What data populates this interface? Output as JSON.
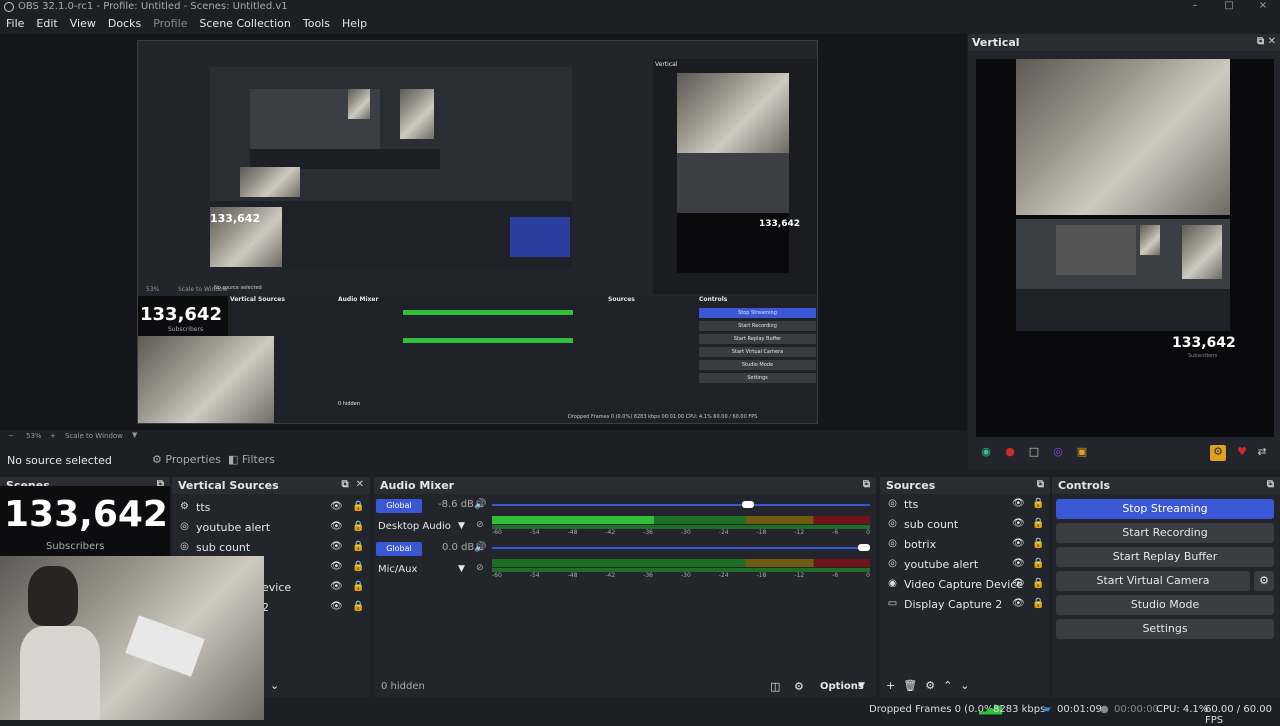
{
  "window": {
    "title": "OBS 32.1.0-rc1 - Profile: Untitled - Scenes: Untitled.v1",
    "min": "–",
    "max": "□",
    "close": "×"
  },
  "menu": [
    "File",
    "Edit",
    "View",
    "Docks",
    "Profile",
    "Scene Collection",
    "Tools",
    "Help"
  ],
  "nested_capture": {
    "counter": "133,642",
    "counter_sub": "Subscribers",
    "no_source": "No source selected",
    "properties": "Properties",
    "filters": "Filters",
    "dock_vertical_sources": "Vertical Sources",
    "dock_audio_mixer": "Audio Mixer",
    "dock_sources": "Sources",
    "dock_controls": "Controls",
    "stop_streaming": "Stop Streaming",
    "start_recording": "Start Recording",
    "start_replay": "Start Replay Buffer",
    "start_vcam": "Start Virtual Camera",
    "studio_mode": "Studio Mode",
    "settings": "Settings",
    "hidden": "0 hidden",
    "options": "Options",
    "vertical": "Vertical",
    "zoom": "53%",
    "scale": "Scale to Window",
    "status": "Dropped Frames 0 (0.0%)   8283 kbps   00:01:00   CPU: 4.1%   60.00 / 60.00 FPS"
  },
  "zoom_bar": {
    "zoom": "53%",
    "scale": "Scale to Window"
  },
  "source_bar": {
    "no_source": "No source selected",
    "properties": "Properties",
    "filters": "Filters"
  },
  "vertical_dock": {
    "title": "Vertical",
    "counter": "133,642",
    "counter_sub": "Subscribers"
  },
  "scenes_dock": {
    "title": "Scenes"
  },
  "overlay": {
    "counter": "133,642",
    "sub": "Subscribers"
  },
  "vertical_sources": {
    "title": "Vertical Sources",
    "items": [
      {
        "name": "tts",
        "icon": "gear-icon"
      },
      {
        "name": "youtube alert",
        "icon": "globe-icon"
      },
      {
        "name": "sub count",
        "icon": "globe-icon"
      },
      {
        "name": "",
        "icon": "globe-icon"
      },
      {
        "name": "evice",
        "icon": "camera-icon"
      },
      {
        "name": "2",
        "icon": "monitor-icon"
      }
    ]
  },
  "audio_mixer": {
    "title": "Audio Mixer",
    "channels": [
      {
        "badge": "Global",
        "db": "-8.6 dB",
        "name": "Desktop Audio"
      },
      {
        "badge": "Global",
        "db": "0.0 dB",
        "name": "Mic/Aux"
      }
    ],
    "ticks": [
      "-60",
      "-54",
      "-48",
      "-42",
      "-36",
      "-30",
      "-24",
      "-18",
      "-12",
      "-6",
      "0"
    ],
    "hidden": "0 hidden",
    "options": "Options"
  },
  "sources": {
    "title": "Sources",
    "items": [
      {
        "name": "tts",
        "icon": "globe-icon"
      },
      {
        "name": "sub count",
        "icon": "globe-icon"
      },
      {
        "name": "botrix",
        "icon": "globe-icon"
      },
      {
        "name": "youtube alert",
        "icon": "globe-icon"
      },
      {
        "name": "Video Capture Device",
        "icon": "camera-icon"
      },
      {
        "name": "Display Capture 2",
        "icon": "monitor-icon"
      }
    ]
  },
  "controls": {
    "title": "Controls",
    "stop_streaming": "Stop Streaming",
    "start_recording": "Start Recording",
    "start_replay": "Start Replay Buffer",
    "start_vcam": "Start Virtual Camera",
    "studio_mode": "Studio Mode",
    "settings": "Settings"
  },
  "status": {
    "dropped": "Dropped Frames 0 (0.0%)",
    "bitrate": "8283 kbps",
    "stream_time": "00:01:09",
    "rec_time": "00:00:00",
    "cpu": "CPU: 4.1%",
    "fps": "60.00 / 60.00 FPS"
  },
  "colors": {
    "accent": "#3a57d6",
    "meter_green": "#2fbf3a",
    "meter_yellow": "#b89a1a",
    "meter_red": "#9a1e24"
  }
}
